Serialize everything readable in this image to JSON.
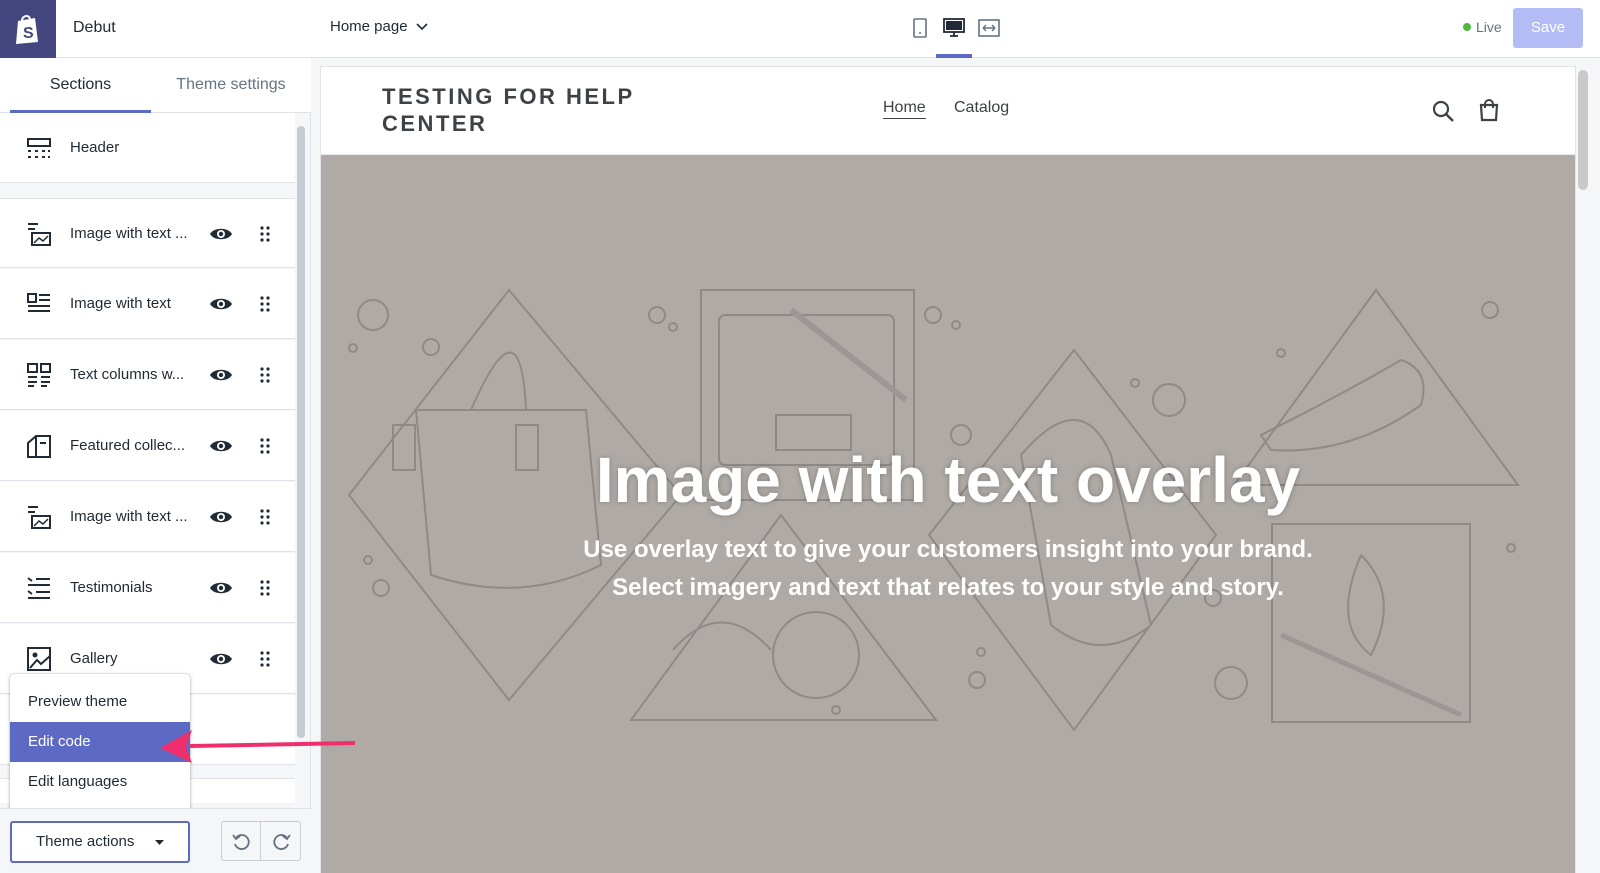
{
  "sidebar": {
    "theme_name": "Debut",
    "tabs": [
      {
        "label": "Sections"
      },
      {
        "label": "Theme settings"
      }
    ],
    "items": [
      {
        "label": "Header"
      },
      {
        "label": "Image with text ..."
      },
      {
        "label": "Image with text"
      },
      {
        "label": "Text columns w..."
      },
      {
        "label": "Featured collec..."
      },
      {
        "label": "Image with text ..."
      },
      {
        "label": "Testimonials"
      },
      {
        "label": "Gallery"
      }
    ],
    "theme_actions_menu": [
      {
        "label": "Preview theme"
      },
      {
        "label": "Edit code"
      },
      {
        "label": "Edit languages"
      }
    ],
    "theme_actions_label": "Theme actions"
  },
  "topbar": {
    "page_select": "Home page",
    "status": "Live",
    "save_label": "Save"
  },
  "preview": {
    "store_title": "TESTING FOR HELP CENTER",
    "nav": [
      {
        "label": "Home"
      },
      {
        "label": "Catalog"
      }
    ],
    "hero_title": "Image with text overlay",
    "hero_sub_line1": "Use overlay text to give your customers insight into your brand.",
    "hero_sub_line2": "Select imagery and text that relates to your style and story."
  },
  "colors": {
    "accent": "#5c6ac4",
    "logo_bg": "#43467f",
    "hero_bg": "#afaaa6",
    "live_dot": "#50b83c",
    "arrow": "#ee2f6c"
  }
}
